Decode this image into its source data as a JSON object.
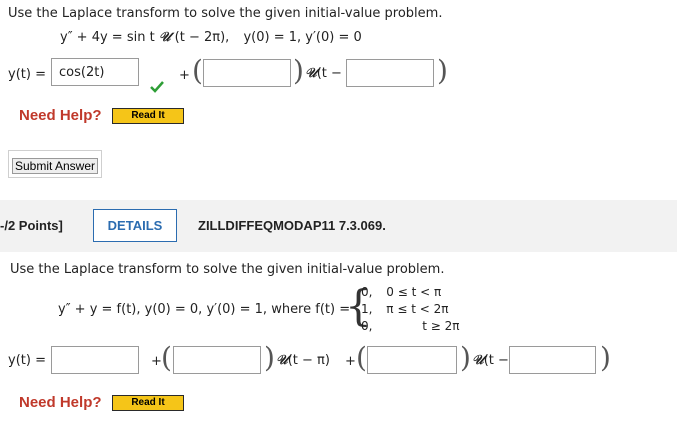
{
  "problem1": {
    "instruction": "Use the Laplace transform to solve the given initial-value problem.",
    "equation": "y″ + 4y = sin t",
    "unit_arg": "(t − 2π),",
    "conditions": "y(0) = 1, y′(0) = 0",
    "answer_label": "y(t) =",
    "answer_value": "cos(2t)",
    "check_color": "#2e9e36",
    "plus": "+",
    "unit_suffix": "(t −",
    "help_label": "Need Help?",
    "read_it": "Read It",
    "submit": "Submit Answer"
  },
  "header2": {
    "points": "-/2 Points]",
    "details": "DETAILS",
    "code": "ZILLDIFFEQMODAP11 7.3.069."
  },
  "problem2": {
    "instruction": "Use the Laplace transform to solve the given initial-value problem.",
    "equation": "y″ + y = f(t),   y(0) = 0, y′(0) = 1, where f(t) =",
    "cases": [
      {
        "value": "0,",
        "condition": "0 ≤ t < π"
      },
      {
        "value": "1,",
        "condition": "π ≤ t < 2π"
      },
      {
        "value": "0,",
        "condition": "t ≥ 2π"
      }
    ],
    "answer_label": "y(t) =",
    "plus": "+",
    "unit_shift1": "(t − π)",
    "unit_suffix": "(t −",
    "help_label": "Need Help?",
    "read_it": "Read It"
  },
  "colors": {
    "help": "#c0392b",
    "accent": "#2b6cb0",
    "read_it_bg": "#f5c518"
  }
}
